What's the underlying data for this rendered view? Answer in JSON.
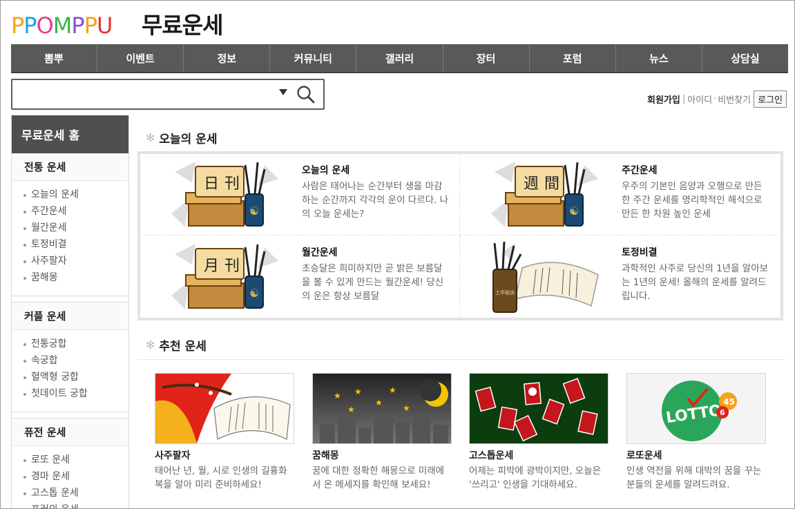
{
  "header": {
    "logo_letters": [
      "P",
      "P",
      "O",
      "M",
      "P",
      "P",
      "U"
    ],
    "logo_colors": [
      "#f7a11a",
      "#1aa3e8",
      "#e83a8f",
      "#3bb54a",
      "#8b4fd8",
      "#f7a11a",
      "#e8322a"
    ],
    "title": "무료운세"
  },
  "nav": [
    "뽐뿌",
    "이벤트",
    "정보",
    "커뮤니티",
    "갤러리",
    "장터",
    "포럼",
    "뉴스",
    "상담실"
  ],
  "search": {
    "value": "",
    "placeholder": ""
  },
  "member": {
    "join": "회원가입",
    "id": "아이디",
    "pw": "비번찾기",
    "login": "로그인"
  },
  "sidebar": {
    "home": "무료운세 홈",
    "groups": [
      {
        "title": "전통 운세",
        "items": [
          "오늘의 운세",
          "주간운세",
          "월간운세",
          "토정비결",
          "사주팔자",
          "꿈해몽"
        ]
      },
      {
        "title": "커플 운세",
        "items": [
          "전통궁합",
          "속궁합",
          "혈액형 궁합",
          "첫데이트 궁합"
        ]
      },
      {
        "title": "퓨전 운세",
        "items": [
          "로또 운세",
          "경마 운세",
          "고스톱 운세",
          "프러의 운세"
        ]
      }
    ]
  },
  "today": {
    "title": "오늘의 운세",
    "cards": [
      {
        "title": "오늘의 운세",
        "desc": "사람은 태어나는 순간부터 생을 마감하는 순간까지 각각의 운이 다르다. 나의 오늘 운세는?",
        "glyphs": [
          "日",
          "刊"
        ]
      },
      {
        "title": "주간운세",
        "desc": "우주의 기본인 음양과 오행으로 만든 한 주간 운세를 명리학적인 해석으로 만든 한 차원 높인 운세",
        "glyphs": [
          "週",
          "間"
        ]
      },
      {
        "title": "월간운세",
        "desc": "초승달은 희미하지만 곧 밝은 보름달을 볼 수 있게 만드는 월간운세! 당신의 운은 항상 보름달",
        "glyphs": [
          "月",
          "刊"
        ]
      },
      {
        "title": "토정비결",
        "desc": "과학적인 사주로 당신의 1년을 알아보는 1년의 운세! 올해의 운세를 알려드립니다.",
        "glyphs": [
          "土亭秘訣"
        ]
      }
    ]
  },
  "recommend": {
    "title": "추천 운세",
    "items": [
      {
        "title": "사주팔자",
        "desc": "태어난 년, 월, 시로 인생의 길흉화복을 알아 미리 준비하세요!"
      },
      {
        "title": "꿈해몽",
        "desc": "꿈에 대한 정확한 해몽으로 미래에서 온 메세지를 확인해 보세요!"
      },
      {
        "title": "고스톱운세",
        "desc": "어제는 피박에 광박이지만, 오늘은 '쓰리고' 인생을 기대하세요."
      },
      {
        "title": "로또운세",
        "desc": "인생 역전을 위해 대박의 꿈을 꾸는 분들의 운세를 알려드려요."
      }
    ],
    "lotto_text": "LOTTO",
    "lotto_nums": [
      "45",
      "6"
    ]
  },
  "icons": {
    "search": "search-icon",
    "dropdown": "dropdown-arrow-icon",
    "bullet": "star-bullet-icon"
  }
}
